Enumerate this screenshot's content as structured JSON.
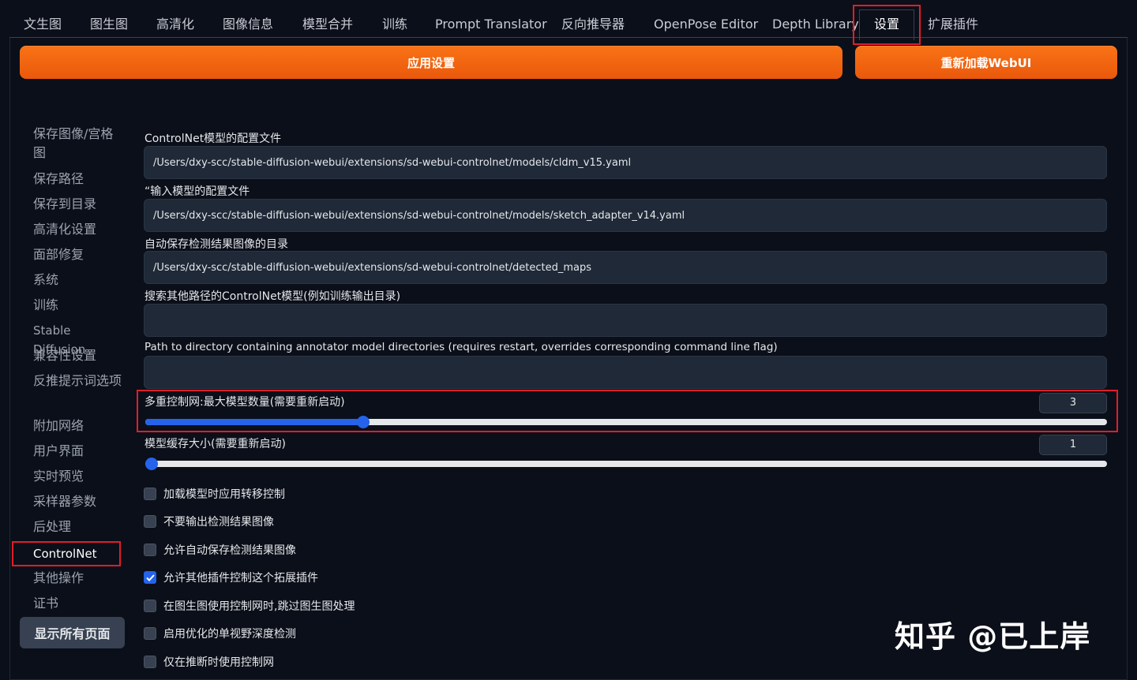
{
  "tabs": [
    {
      "label": "文生图"
    },
    {
      "label": "图生图"
    },
    {
      "label": "高清化"
    },
    {
      "label": "图像信息"
    },
    {
      "label": "模型合并"
    },
    {
      "label": "训练"
    },
    {
      "label": "Prompt Translator"
    },
    {
      "label": "反向推导器"
    },
    {
      "label": "OpenPose Editor"
    },
    {
      "label": "Depth Library"
    },
    {
      "label": "设置",
      "active": true
    },
    {
      "label": "扩展插件"
    }
  ],
  "actions": {
    "apply_label": "应用设置",
    "reload_label": "重新加载WebUI"
  },
  "sidebar": {
    "items": [
      {
        "label": "保存图像/宫格图"
      },
      {
        "label": "保存路径"
      },
      {
        "label": "保存到目录"
      },
      {
        "label": "高清化设置"
      },
      {
        "label": "面部修复"
      },
      {
        "label": "系统"
      },
      {
        "label": "训练"
      },
      {
        "label": "Stable Diffusion"
      },
      {
        "label": "兼容性设置"
      },
      {
        "label": "反推提示词选项"
      },
      {
        "label": "附加网络"
      },
      {
        "label": "用户界面"
      },
      {
        "label": "实时预览"
      },
      {
        "label": "采样器参数"
      },
      {
        "label": "后处理"
      },
      {
        "label": "ControlNet",
        "active": true
      },
      {
        "label": "其他操作"
      },
      {
        "label": "证书"
      }
    ],
    "show_all_label": "显示所有页面"
  },
  "settings": {
    "config_file": {
      "label": "ControlNet模型的配置文件",
      "value": "/Users/dxy-scc/stable-diffusion-webui/extensions/sd-webui-controlnet/models/cldm_v15.yaml"
    },
    "adapter_config": {
      "label": "“输入模型的配置文件",
      "value": "/Users/dxy-scc/stable-diffusion-webui/extensions/sd-webui-controlnet/models/sketch_adapter_v14.yaml"
    },
    "detected_dir": {
      "label": "自动保存检测结果图像的目录",
      "value": "/Users/dxy-scc/stable-diffusion-webui/extensions/sd-webui-controlnet/detected_maps"
    },
    "extra_models_path": {
      "label": "搜索其他路径的ControlNet模型(例如训练输出目录)",
      "value": ""
    },
    "annotator_path": {
      "label": "Path to directory containing annotator model directories (requires restart, overrides corresponding command line flag)",
      "value": ""
    },
    "max_models": {
      "label": "多重控制网:最大模型数量(需要重新启动)",
      "value": "3",
      "level": 0.227
    },
    "cache_size": {
      "label": "模型缓存大小(需要重新启动)",
      "value": "1",
      "level": 0.0
    },
    "checkboxes": [
      {
        "label": "加载模型时应用转移控制",
        "checked": false
      },
      {
        "label": "不要输出检测结果图像",
        "checked": false
      },
      {
        "label": "允许自动保存检测结果图像",
        "checked": false
      },
      {
        "label": "允许其他插件控制这个拓展插件",
        "checked": true
      },
      {
        "label": "在图生图使用控制网时,跳过图生图处理",
        "checked": false
      },
      {
        "label": "启用优化的单视野深度检测",
        "checked": false
      },
      {
        "label": "仅在推断时使用控制网",
        "checked": false
      }
    ]
  },
  "watermark": "知乎 @已上岸",
  "colors": {
    "accent": "#f97316",
    "highlight": "#e11d2a",
    "slider": "#2563eb",
    "background": "#0b0f19"
  }
}
